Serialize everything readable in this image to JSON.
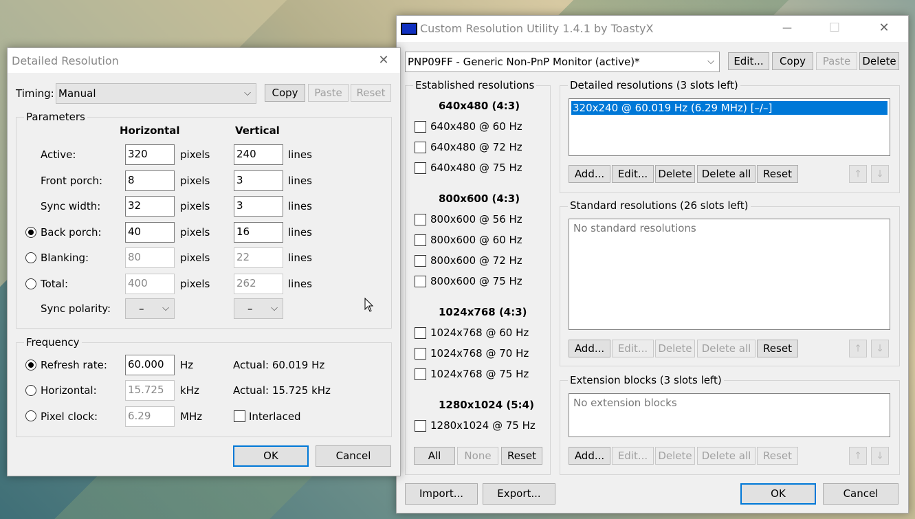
{
  "cru": {
    "title": "Custom Resolution Utility 1.4.1 by ToastyX",
    "monitor": "PNP09FF - Generic Non-PnP Monitor (active)*",
    "top_buttons": {
      "edit": "Edit...",
      "copy": "Copy",
      "paste": "Paste",
      "delete": "Delete"
    },
    "established": {
      "title": "Established resolutions",
      "groups": [
        {
          "header": "640x480 (4:3)",
          "items": [
            "640x480 @ 60 Hz",
            "640x480 @ 72 Hz",
            "640x480 @ 75 Hz"
          ]
        },
        {
          "header": "800x600 (4:3)",
          "items": [
            "800x600 @ 56 Hz",
            "800x600 @ 60 Hz",
            "800x600 @ 72 Hz",
            "800x600 @ 75 Hz"
          ]
        },
        {
          "header": "1024x768 (4:3)",
          "items": [
            "1024x768 @ 60 Hz",
            "1024x768 @ 70 Hz",
            "1024x768 @ 75 Hz"
          ]
        },
        {
          "header": "1280x1024 (5:4)",
          "items": [
            "1280x1024 @ 75 Hz"
          ]
        }
      ],
      "buttons": {
        "all": "All",
        "none": "None",
        "reset": "Reset"
      }
    },
    "detailed": {
      "title": "Detailed resolutions (3 slots left)",
      "items": [
        "320x240 @ 60.019 Hz (6.29 MHz) [–/–]"
      ]
    },
    "standard": {
      "title": "Standard resolutions (26 slots left)",
      "empty": "No standard resolutions"
    },
    "extension": {
      "title": "Extension blocks (3 slots left)",
      "empty": "No extension blocks"
    },
    "list_buttons": {
      "add": "Add...",
      "edit": "Edit...",
      "delete": "Delete",
      "delete_all": "Delete all",
      "reset": "Reset"
    },
    "arrows": {
      "up": "🡑",
      "down": "🡓"
    },
    "bottom": {
      "import": "Import...",
      "export": "Export...",
      "ok": "OK",
      "cancel": "Cancel"
    }
  },
  "detail": {
    "title": "Detailed Resolution",
    "timing_label": "Timing:",
    "timing_value": "Manual",
    "buttons": {
      "copy": "Copy",
      "paste": "Paste",
      "reset": "Reset"
    },
    "parameters_title": "Parameters",
    "col_horizontal": "Horizontal",
    "col_vertical": "Vertical",
    "rows": [
      {
        "label": "Active:",
        "h": "320",
        "v": "240"
      },
      {
        "label": "Front porch:",
        "h": "8",
        "v": "3"
      },
      {
        "label": "Sync width:",
        "h": "32",
        "v": "3"
      },
      {
        "label": "Back porch:",
        "h": "40",
        "v": "16"
      },
      {
        "label": "Blanking:",
        "h": "80",
        "v": "22"
      },
      {
        "label": "Total:",
        "h": "400",
        "v": "262"
      }
    ],
    "unit_h": "pixels",
    "unit_v": "lines",
    "sync_label": "Sync polarity:",
    "sync_h": "–",
    "sync_v": "–",
    "frequency_title": "Frequency",
    "refresh_label": "Refresh rate:",
    "refresh_value": "60.000",
    "refresh_unit": "Hz",
    "refresh_actual": "Actual: 60.019 Hz",
    "horizontal_label": "Horizontal:",
    "horizontal_value": "15.725",
    "horizontal_unit": "kHz",
    "horizontal_actual": "Actual: 15.725 kHz",
    "pixel_label": "Pixel clock:",
    "pixel_value": "6.29",
    "pixel_unit": "MHz",
    "interlaced_label": "Interlaced",
    "ok": "OK",
    "cancel": "Cancel"
  },
  "titlebar_glyphs": {
    "close": "✕",
    "minimize": "—",
    "maximize": "☐"
  }
}
